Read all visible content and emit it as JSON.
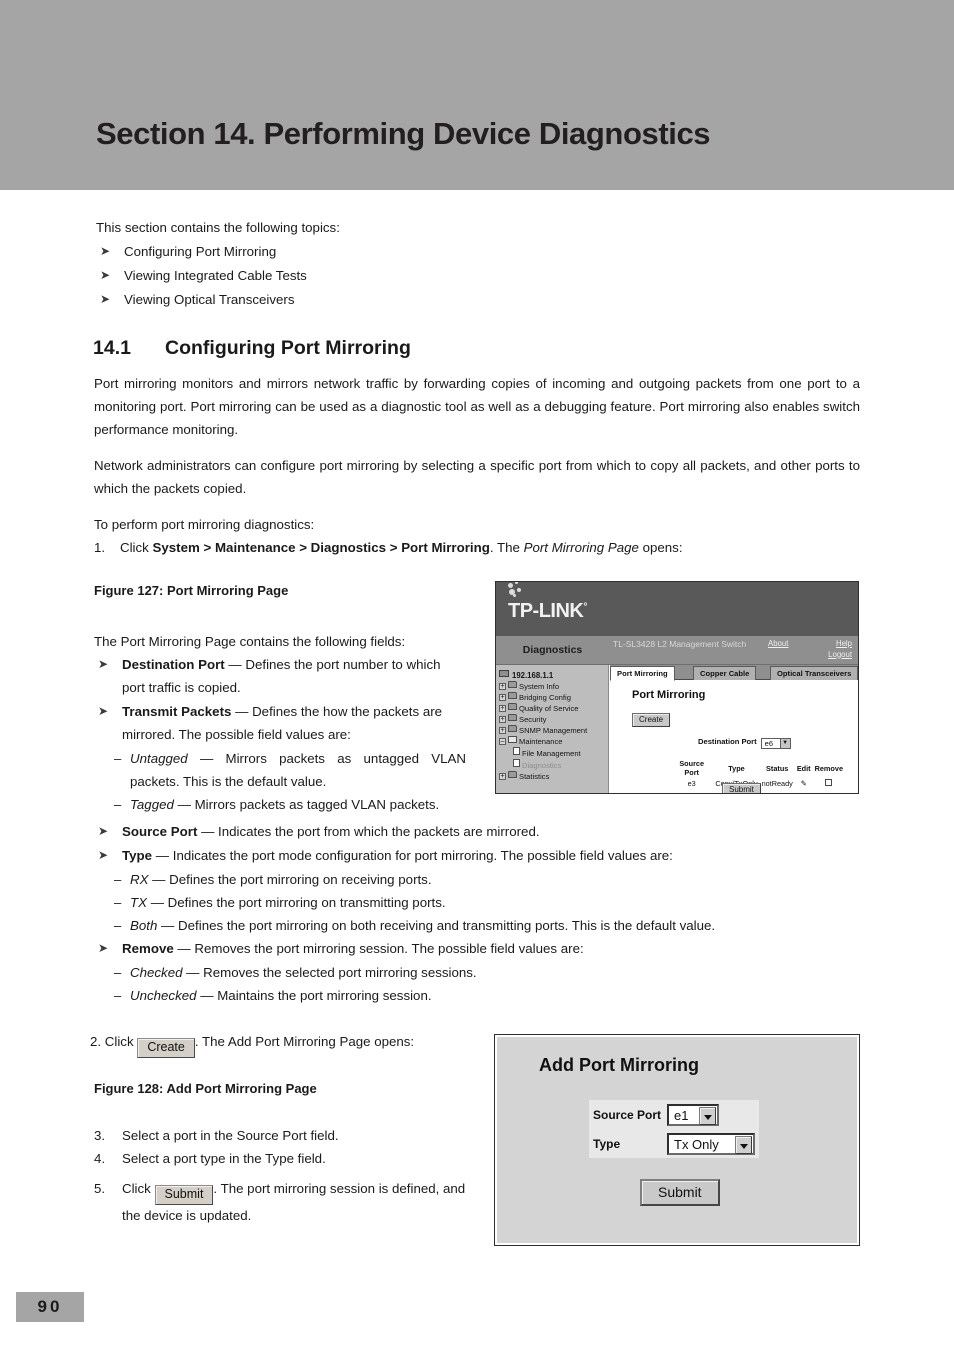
{
  "section": {
    "banner_title": "Section 14.  Performing Device Diagnostics",
    "banner_color": "#a5a5a5"
  },
  "intro": {
    "lead": "This section contains the following topics:",
    "topics": [
      "Configuring Port Mirroring",
      "Viewing Integrated Cable Tests",
      "Viewing Optical Transceivers"
    ]
  },
  "heading": {
    "number": "14.1",
    "text": "Configuring Port Mirroring"
  },
  "body": {
    "p1": "Port mirroring monitors and mirrors network traffic by forwarding copies of incoming and outgoing packets from one port to a monitoring port. Port mirroring can be used as a diagnostic tool as well as a debugging feature. Port mirroring also enables switch performance monitoring.",
    "p2": "Network administrators can configure port mirroring by selecting a specific port from which to copy all packets, and other ports to which the packets copied.",
    "p3": "To perform port mirroring diagnostics:",
    "step1_num": "1.",
    "step1_pre": "Click ",
    "step1_path": "System > Maintenance > Diagnostics > Port Mirroring",
    "step1_mid": ". The ",
    "step1_italic": "Port Mirroring Page",
    "step1_post": " opens:"
  },
  "figure127": {
    "caption": "Figure 127: Port Mirroring Page",
    "fields_lead": "The Port Mirroring Page contains the following fields:",
    "fields": [
      {
        "term": "Destination Port",
        "desc": " — Defines the port number to which port traffic is copied."
      },
      {
        "term": "Transmit Packets",
        "desc": " — Defines the how the packets are mirrored. The possible field values are:",
        "subs": [
          {
            "term": "Untagged",
            "desc": " — Mirrors packets as untagged VLAN packets. This is the default value."
          },
          {
            "term": "Tagged",
            "desc": " — Mirrors packets as tagged VLAN packets."
          }
        ]
      }
    ],
    "fields_wide": [
      {
        "term": "Source Port",
        "desc": " — Indicates the port from which the packets are mirrored."
      },
      {
        "term": "Type",
        "desc": " — Indicates the port mode configuration for port mirroring. The possible field values are:",
        "subs": [
          {
            "term": "RX",
            "desc": " — Defines the port mirroring on receiving ports."
          },
          {
            "term": "TX",
            "desc": " — Defines the port mirroring on transmitting ports."
          },
          {
            "term": "Both",
            "desc": " — Defines the port mirroring on both receiving and transmitting ports. This is the default value."
          }
        ]
      },
      {
        "term": "Remove",
        "desc": " — Removes the port mirroring session. The possible field values are:",
        "subs": [
          {
            "term": "Checked",
            "desc": " — Removes the selected port mirroring sessions."
          },
          {
            "term": "Unchecked",
            "desc": " — Maintains the port mirroring session."
          }
        ]
      }
    ]
  },
  "device_ui": {
    "brand": "TP-LINK",
    "brand_tm": "°",
    "section_name": "Diagnostics",
    "model": "TL-SL3428 L2 Management Switch",
    "links": {
      "about": "About",
      "help": "Help",
      "logout": "Logout"
    },
    "tree": [
      {
        "label": "192.168.1.1",
        "type": "root"
      },
      {
        "label": "System Info",
        "type": "folder"
      },
      {
        "label": "Bridging Config",
        "type": "folder"
      },
      {
        "label": "Quality of Service",
        "type": "folder"
      },
      {
        "label": "Security",
        "type": "folder"
      },
      {
        "label": "SNMP Management",
        "type": "folder"
      },
      {
        "label": "Maintenance",
        "type": "folder-open"
      },
      {
        "label": "File Management",
        "type": "page"
      },
      {
        "label": "Diagnostics",
        "type": "page-dim"
      },
      {
        "label": "Statistics",
        "type": "folder"
      }
    ],
    "tabs": [
      {
        "label": "Port Mirroring",
        "active": true
      },
      {
        "label": "Copper Cable",
        "active": false
      },
      {
        "label": "Optical Transceivers",
        "active": false
      }
    ],
    "panel_title": "Port Mirroring",
    "create_button": "Create",
    "destination_port_label": "Destination Port",
    "destination_port_value": "e6",
    "table": {
      "headers": [
        "Source Port",
        "Type",
        "Status",
        "Edit",
        "Remove"
      ],
      "rows": [
        {
          "source_port": "e3",
          "type": "Copy/TxOnly",
          "status": "notReady",
          "edit": "✎",
          "remove": ""
        }
      ]
    },
    "submit_button": "Submit"
  },
  "steps_lower": {
    "step2_num": "2.",
    "step2_pre": "Click ",
    "step2_btn": "Create",
    "step2_post": ". The Add Port Mirroring Page opens:",
    "figure128_caption": "Figure 128: Add Port Mirroring Page",
    "step3_num": "3.",
    "step3": "Select a port in the Source Port field.",
    "step4_num": "4.",
    "step4": "Select a port type in the Type field.",
    "step5_num": "5.",
    "step5_pre": "Click ",
    "step5_btn": "Submit",
    "step5_post": ". The port mirroring session is defined, and the device is updated."
  },
  "add_port_mirroring": {
    "title": "Add Port Mirroring",
    "source_port_label": "Source Port",
    "source_port_value": "e1",
    "type_label": "Type",
    "type_value": "Tx Only",
    "submit_button": "Submit"
  },
  "footer": {
    "page_number": "90"
  }
}
